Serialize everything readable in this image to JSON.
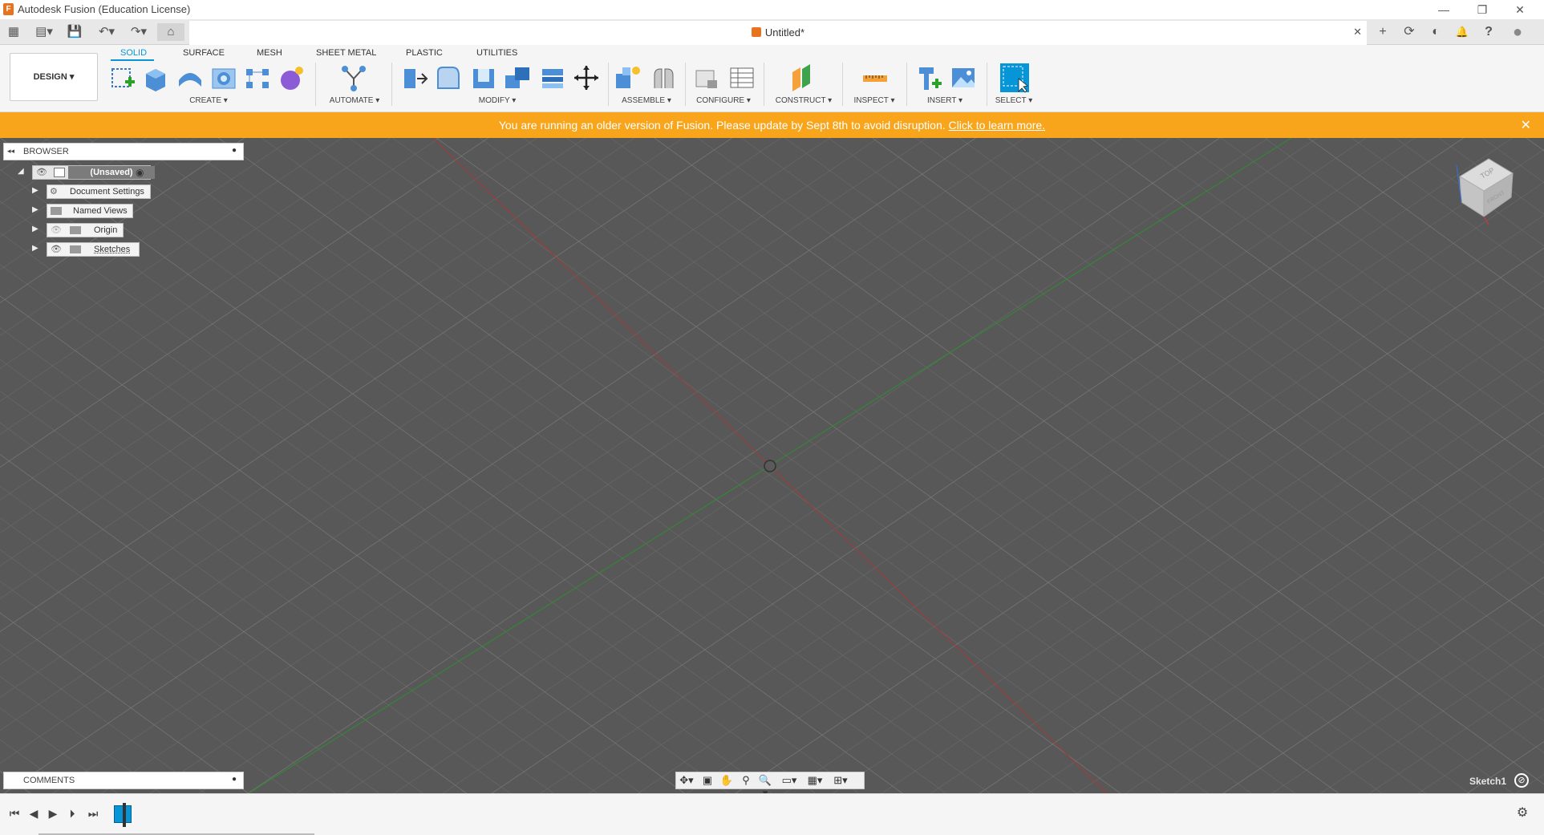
{
  "window": {
    "title": "Autodesk Fusion (Education License)",
    "logo_letter": "F",
    "minimize": "—",
    "maximize": "❐",
    "close": "✕"
  },
  "qat": {
    "grid_icon": "▦",
    "file_icon": "▤▾",
    "save_icon": "💾",
    "undo_icon": "↶▾",
    "redo_icon": "↷▾",
    "home_icon": "⌂"
  },
  "document_tab": {
    "title": "Untitled*",
    "close": "✕"
  },
  "right_tools": {
    "new_tab": "+",
    "job_status": "⟳",
    "online": "◐",
    "notifications": "🔔",
    "help": "?",
    "profile": "●"
  },
  "ribbon": {
    "tabs": [
      "SOLID",
      "SURFACE",
      "MESH",
      "SHEET METAL",
      "PLASTIC",
      "UTILITIES"
    ],
    "active_tab": "SOLID",
    "workspace": "DESIGN ▾",
    "groups": {
      "create": "CREATE ▾",
      "automate": "AUTOMATE ▾",
      "modify": "MODIFY ▾",
      "assemble": "ASSEMBLE ▾",
      "configure": "CONFIGURE ▾",
      "construct": "CONSTRUCT ▾",
      "inspect": "INSPECT ▾",
      "insert": "INSERT ▾",
      "select": "SELECT ▾"
    }
  },
  "banner": {
    "message": "You are running an older version of Fusion. Please update by Sept 8th to avoid disruption.",
    "link": "Click to learn more.",
    "close": "✕",
    "color": "#f8a51b"
  },
  "browser": {
    "title": "BROWSER",
    "collapse_icon": "◂◂",
    "pin_icon": "●",
    "root": "(Unsaved)",
    "items": [
      "Document Settings",
      "Named Views",
      "Origin",
      "Sketches"
    ]
  },
  "viewcube": {
    "face": "TOP",
    "side": "FRONT"
  },
  "comments": {
    "title": "COMMENTS",
    "pin_icon": "●"
  },
  "status": {
    "sketch_label": "Sketch1"
  },
  "colors": {
    "accent": "#0696d7",
    "viewport": "#585858",
    "x_axis": "#b03030",
    "y_axis": "#2e9e2e"
  }
}
